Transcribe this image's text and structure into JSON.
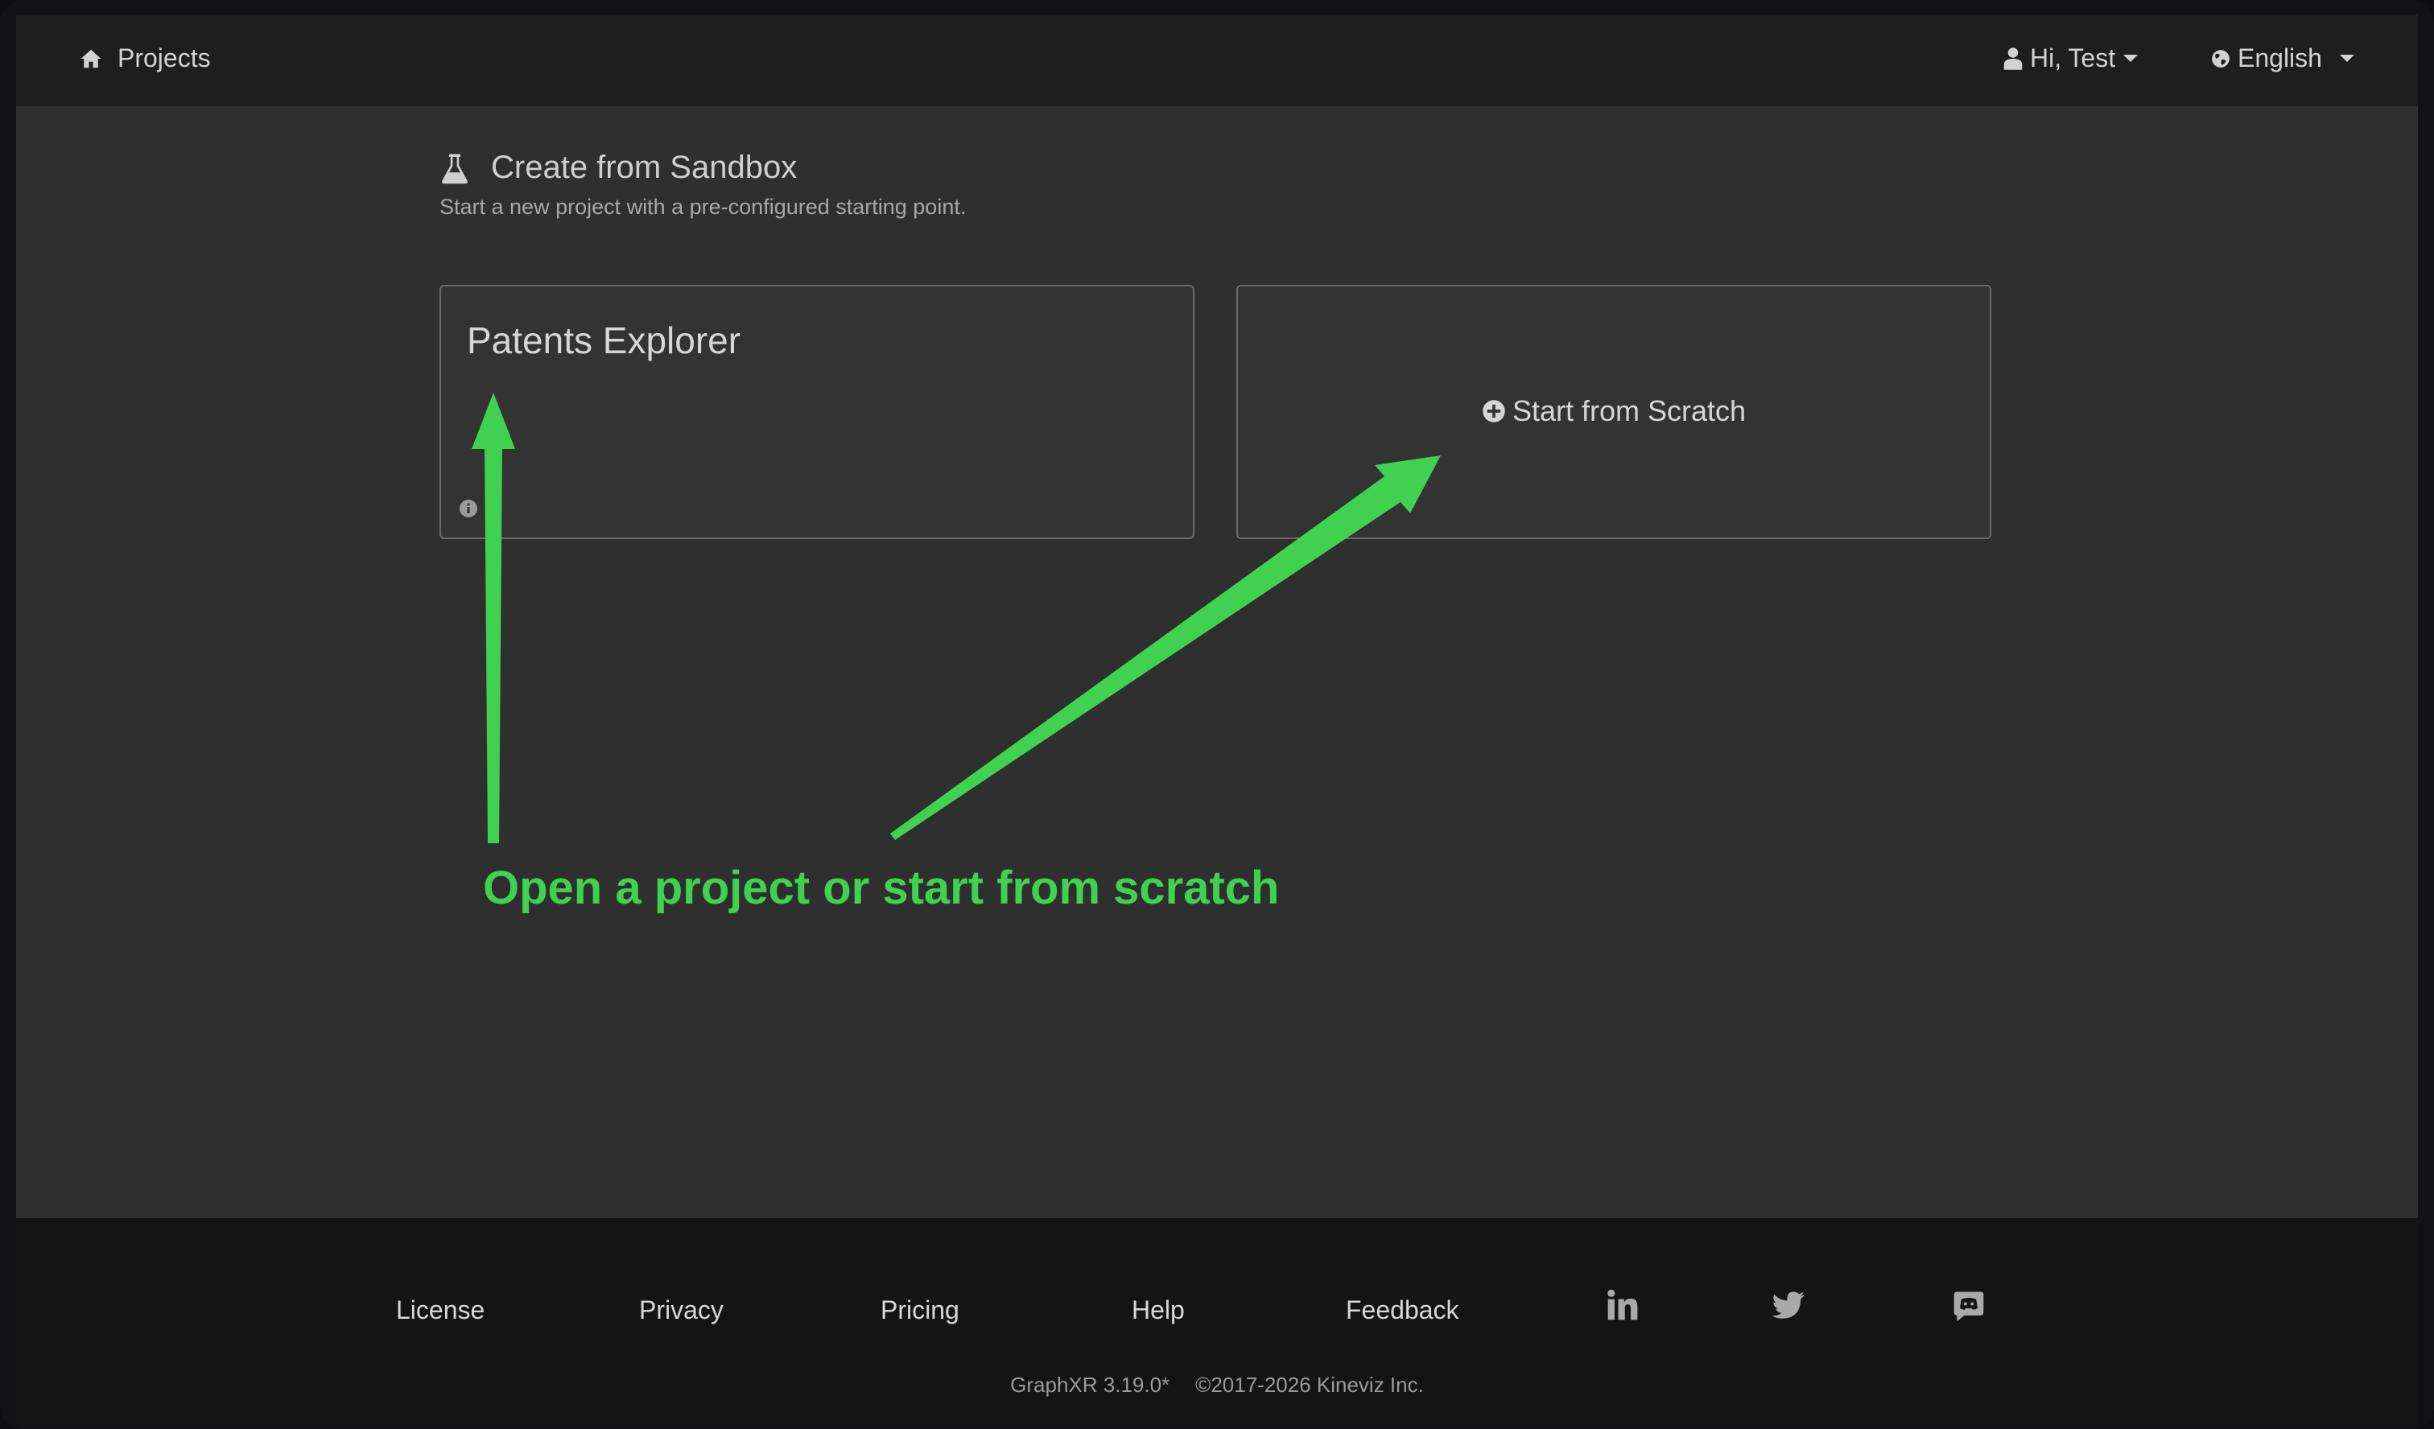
{
  "nav": {
    "home_label": "Projects",
    "user_label": "Hi, Test",
    "language_label": "English"
  },
  "header": {
    "title": "Create from Sandbox",
    "subtitle": "Start a new project with a pre-configured starting point."
  },
  "cards": {
    "patents_title": "Patents Explorer",
    "scratch_label": "Start from Scratch"
  },
  "annotation": {
    "text": "Open a project or start from scratch",
    "color": "#3fd14f"
  },
  "footer": {
    "links": [
      "License",
      "Privacy",
      "Pricing",
      "Help",
      "Feedback"
    ],
    "version": "GraphXR 3.19.0*",
    "copyright": "©2017-2026 Kineviz Inc."
  },
  "icons": [
    "home-icon",
    "user-icon",
    "globe-icon",
    "flask-icon",
    "info-icon",
    "plus-circle-icon",
    "linkedin-icon",
    "twitter-icon",
    "discord-icon"
  ]
}
